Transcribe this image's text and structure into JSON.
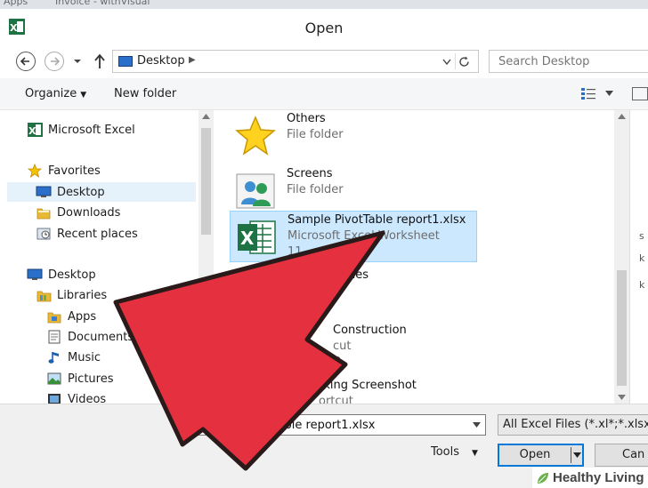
{
  "browser_bar": {
    "left_text": "Apps",
    "tab_text": "Invoice - withVisual"
  },
  "window": {
    "title": "Open"
  },
  "address": {
    "location": "Desktop",
    "search_placeholder": "Search Desktop"
  },
  "toolbar": {
    "organize_label": "Organize",
    "new_folder_label": "New folder"
  },
  "nav": {
    "items": [
      {
        "label": "Microsoft Excel",
        "icon": "excel-icon"
      },
      {
        "label": "Favorites",
        "icon": "star-icon"
      },
      {
        "label": "Desktop",
        "icon": "desktop-icon"
      },
      {
        "label": "Downloads",
        "icon": "folder-icon"
      },
      {
        "label": "Recent places",
        "icon": "recent-places-icon"
      },
      {
        "label": "Desktop",
        "icon": "desktop-icon"
      },
      {
        "label": "Libraries",
        "icon": "libraries-icon"
      },
      {
        "label": "Apps",
        "icon": "apps-folder-icon"
      },
      {
        "label": "Documents",
        "icon": "documents-icon"
      },
      {
        "label": "Music",
        "icon": "music-icon"
      },
      {
        "label": "Pictures",
        "icon": "pictures-icon"
      },
      {
        "label": "Videos",
        "icon": "videos-icon"
      }
    ]
  },
  "files": [
    {
      "name": "Others",
      "type": "File folder",
      "size": "",
      "icon": "star-folder-icon"
    },
    {
      "name": "Screens",
      "type": "File folder",
      "size": "",
      "icon": "people-folder-icon"
    },
    {
      "name": "Sample PivotTable report1.xlsx",
      "type": "Microsoft Excel Worksheet",
      "size": "11",
      "icon": "excel-file-icon"
    },
    {
      "name": "nes",
      "type": "",
      "size": "",
      "icon": "generic-file-icon"
    },
    {
      "name": "Construction",
      "type": "cut",
      "size": "KB",
      "icon": "shortcut-icon"
    },
    {
      "name": "rking Screenshot",
      "type": "ortcut",
      "size": "",
      "icon": "shortcut-icon"
    }
  ],
  "bottom": {
    "filename_label": "e:",
    "filename_value": "Sample PivotTable report1.xlsx",
    "filetype_value": "All Excel Files (*.xl*;*.xlsx;*.x",
    "tools_label": "Tools",
    "open_label": "Open",
    "cancel_label": "Can"
  },
  "watermark": {
    "text": "Healthy Living"
  },
  "colors": {
    "arrow_red": "#e4303f",
    "selection_blue": "#cce8ff",
    "excel_green": "#1f7244",
    "accent_blue": "#0078d7"
  }
}
